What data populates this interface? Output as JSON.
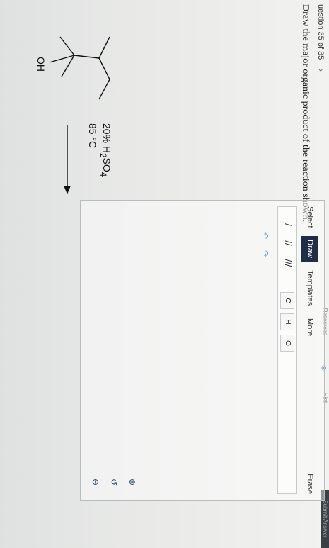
{
  "header": {
    "question_counter": "uestion 35 of 35",
    "next_chevron": "›",
    "submit_label": "Submit Answer",
    "top_labels": [
      "Resources",
      "Hint"
    ]
  },
  "question": {
    "text": "Draw the major organic product of the reaction shown."
  },
  "molecule": {
    "oh_label": "OH"
  },
  "reaction": {
    "reagent_line1_pre": "20% H",
    "reagent_line1_sub1": "2",
    "reagent_line1_mid": "SO",
    "reagent_line1_sub2": "4",
    "reagent_line2": "85 °C"
  },
  "editor": {
    "tabs": [
      {
        "label": "Select",
        "active": false
      },
      {
        "label": "Draw",
        "active": true
      },
      {
        "label": "Templates",
        "active": false
      },
      {
        "label": "More",
        "active": false
      }
    ],
    "erase_label": "Erase",
    "bond_tools": [
      "/",
      "//",
      "///"
    ],
    "atom_tools": [
      "C",
      "H",
      "O"
    ],
    "side_icons": [
      "undo-icon",
      "redo-icon"
    ],
    "zoom_icons": [
      "zoom-in-icon",
      "reset-icon",
      "zoom-out-icon"
    ],
    "reset_glyph": "↺"
  },
  "colors": {
    "accent": "#1f2e46",
    "link": "#6aa0c8"
  }
}
